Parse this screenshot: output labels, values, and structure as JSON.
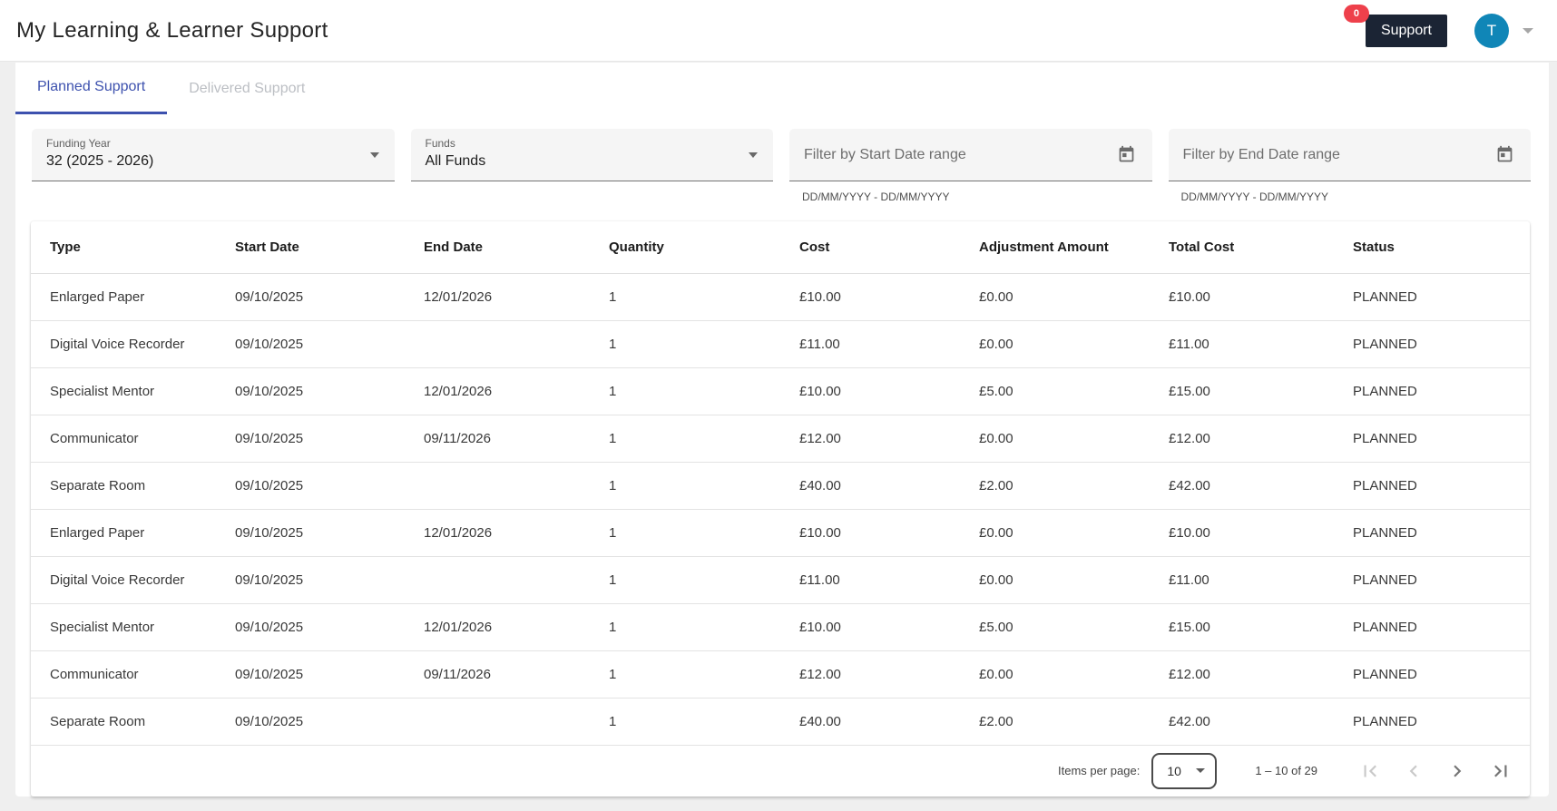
{
  "header": {
    "title": "My Learning & Learner Support",
    "support": {
      "label": "Support",
      "badge_count": "0"
    },
    "user": {
      "initial": "T"
    }
  },
  "tabs": [
    {
      "label": "Planned Support"
    },
    {
      "label": "Delivered Support"
    }
  ],
  "filters": {
    "funding_year": {
      "label": "Funding Year",
      "value": "32 (2025 - 2026)"
    },
    "funds": {
      "label": "Funds",
      "value": "All Funds"
    },
    "start_date_range": {
      "placeholder": "Filter by Start Date range",
      "hint": "DD/MM/YYYY - DD/MM/YYYY"
    },
    "end_date_range": {
      "placeholder": "Filter by End Date range",
      "hint": "DD/MM/YYYY - DD/MM/YYYY"
    }
  },
  "table": {
    "columns": [
      "Type",
      "Start Date",
      "End Date",
      "Quantity",
      "Cost",
      "Adjustment Amount",
      "Total Cost",
      "Status"
    ],
    "rows": [
      [
        "Enlarged Paper",
        "09/10/2025",
        "12/01/2026",
        "1",
        "£10.00",
        "£0.00",
        "£10.00",
        "PLANNED"
      ],
      [
        "Digital Voice Recorder",
        "09/10/2025",
        "",
        "1",
        "£11.00",
        "£0.00",
        "£11.00",
        "PLANNED"
      ],
      [
        "Specialist Mentor",
        "09/10/2025",
        "12/01/2026",
        "1",
        "£10.00",
        "£5.00",
        "£15.00",
        "PLANNED"
      ],
      [
        "Communicator",
        "09/10/2025",
        "09/11/2026",
        "1",
        "£12.00",
        "£0.00",
        "£12.00",
        "PLANNED"
      ],
      [
        "Separate Room",
        "09/10/2025",
        "",
        "1",
        "£40.00",
        "£2.00",
        "£42.00",
        "PLANNED"
      ],
      [
        "Enlarged Paper",
        "09/10/2025",
        "12/01/2026",
        "1",
        "£10.00",
        "£0.00",
        "£10.00",
        "PLANNED"
      ],
      [
        "Digital Voice Recorder",
        "09/10/2025",
        "",
        "1",
        "£11.00",
        "£0.00",
        "£11.00",
        "PLANNED"
      ],
      [
        "Specialist Mentor",
        "09/10/2025",
        "12/01/2026",
        "1",
        "£10.00",
        "£5.00",
        "£15.00",
        "PLANNED"
      ],
      [
        "Communicator",
        "09/10/2025",
        "09/11/2026",
        "1",
        "£12.00",
        "£0.00",
        "£12.00",
        "PLANNED"
      ],
      [
        "Separate Room",
        "09/10/2025",
        "",
        "1",
        "£40.00",
        "£2.00",
        "£42.00",
        "PLANNED"
      ]
    ]
  },
  "pagination": {
    "items_per_page_label": "Items per page:",
    "items_per_page": "10",
    "range": "1 – 10 of 29"
  },
  "colors": {
    "accent": "#3d51ae",
    "support_button_bg": "#1b2434",
    "badge_bg": "#ee404b",
    "avatar_bg": "#1086b7",
    "page_bg": "#efefef"
  }
}
